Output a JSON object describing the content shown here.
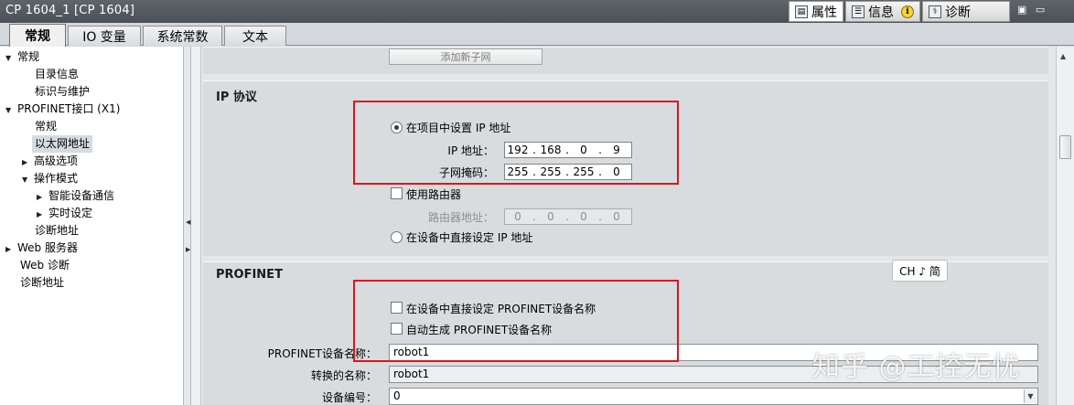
{
  "window": {
    "title": "CP 1604_1 [CP 1604]",
    "right_tabs": [
      {
        "label": "属性",
        "icon": "properties-icon"
      },
      {
        "label": "信息",
        "icon": "info-list-icon"
      },
      {
        "label": "诊断",
        "icon": "diagnostics-icon"
      }
    ],
    "info_badge": "i",
    "window_controls": "▣ ▭"
  },
  "tabs": [
    "常规",
    "IO 变量",
    "系统常数",
    "文本"
  ],
  "active_tab": "常规",
  "tree": [
    {
      "label": "常规",
      "level": 0,
      "expanded": true
    },
    {
      "label": "目录信息",
      "level": 1
    },
    {
      "label": "标识与维护",
      "level": 1
    },
    {
      "label": "PROFINET接口 (X1)",
      "level": 0,
      "expanded": true
    },
    {
      "label": "常规",
      "level": 1
    },
    {
      "label": "以太网地址",
      "level": 1,
      "selected": true
    },
    {
      "label": "高级选项",
      "level": 1,
      "expanded": false
    },
    {
      "label": "操作模式",
      "level": 1,
      "expanded": true
    },
    {
      "label": "智能设备通信",
      "level": 2,
      "expanded": false
    },
    {
      "label": "实时设定",
      "level": 2,
      "expanded": false
    },
    {
      "label": "诊断地址",
      "level": 1
    },
    {
      "label": "Web 服务器",
      "level": 0,
      "expanded": false
    },
    {
      "label": "Web 诊断",
      "level": 0
    },
    {
      "label": "诊断地址",
      "level": 0
    }
  ],
  "subnet": {
    "add_button": "添加新子网"
  },
  "ip_protocol": {
    "title": "IP 协议",
    "set_in_project": "在项目中设置 IP 地址",
    "ip_label": "IP 地址：",
    "ip": [
      "192",
      "168",
      "0",
      "9"
    ],
    "mask_label": "子网掩码：",
    "mask": [
      "255",
      "255",
      "255",
      "0"
    ],
    "use_router": "使用路由器",
    "router_label": "路由器地址：",
    "router": [
      "0",
      "0",
      "0",
      "0"
    ],
    "set_on_device": "在设备中直接设定 IP 地址"
  },
  "profinet": {
    "title": "PROFINET",
    "set_name_on_device": "在设备中直接设定 PROFINET设备名称",
    "auto_generate": "自动生成 PROFINET设备名称",
    "name_label": "PROFINET设备名称：",
    "name_value": "robot1",
    "converted_label": "转换的名称：",
    "converted_value": "robot1",
    "device_no_label": "设备编号：",
    "device_no_value": "0"
  },
  "ime_indicator": "CH ♪ 简",
  "watermark": "知乎 @工控无忧",
  "colors": {
    "highlight_box": "#e0141c",
    "selected_radio": "#1e3e6b",
    "titlebar": "#50575d"
  }
}
